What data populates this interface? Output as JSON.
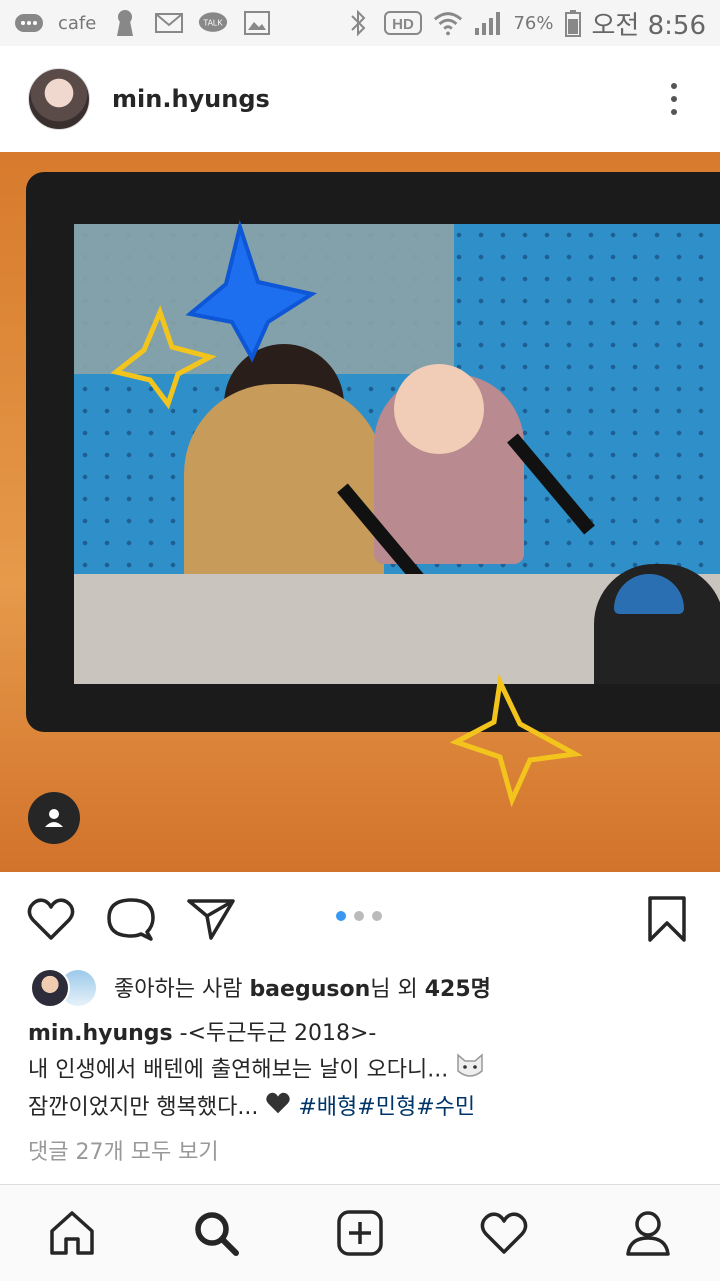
{
  "status_bar": {
    "cafe_label": "cafe",
    "talk_label": "TALK",
    "hd_label": "HD",
    "battery": "76%",
    "time": "오전 8:56"
  },
  "post": {
    "username": "min.hyungs",
    "likes": {
      "prefix": "좋아하는 사람 ",
      "user": "baeguson",
      "suffix": "님 외 ",
      "count": "425명"
    },
    "caption": {
      "username": "min.hyungs",
      "line1": " -<두근두근 2018>-",
      "line2": "내 인생에서 배텐에 출연해보는 날이 오다니...",
      "line3": "잠깐이었지만 행복했다...",
      "hashtags": [
        "#배형",
        "#민형",
        "#수민"
      ]
    },
    "view_comments": "댓글 27개 모두 보기",
    "carousel": {
      "total": 3,
      "active": 1
    }
  },
  "colors": {
    "accent": "#3897f0",
    "hashtag": "#003569"
  },
  "icons": {
    "header": "more-vertical-icon",
    "actions": [
      "heart-icon",
      "comment-icon",
      "share-icon",
      "bookmark-icon"
    ],
    "nav": [
      "home-icon",
      "search-icon",
      "add-icon",
      "activity-heart-icon",
      "profile-icon"
    ]
  }
}
